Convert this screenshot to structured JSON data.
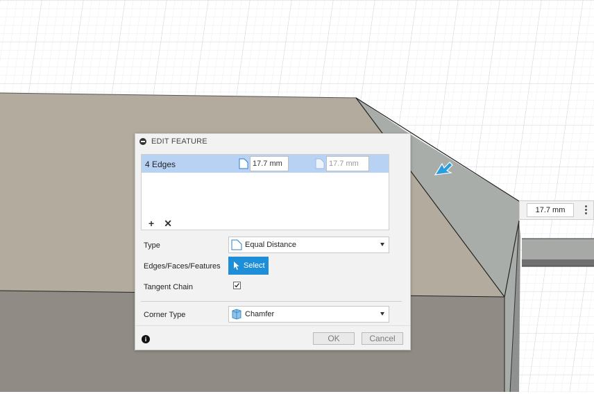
{
  "dialog": {
    "title": "EDIT FEATURE",
    "selection": {
      "label": "4 Edges",
      "distance_1": "17.7 mm",
      "distance_2": "17.7 mm"
    },
    "type": {
      "label": "Type",
      "value": "Equal Distance"
    },
    "edges": {
      "label": "Edges/Faces/Features",
      "button": "Select"
    },
    "tangent_chain": {
      "label": "Tangent Chain",
      "checked": true
    },
    "corner_type": {
      "label": "Corner Type",
      "value": "Chamfer"
    },
    "ok_label": "OK",
    "cancel_label": "Cancel"
  },
  "viewport": {
    "manipulator_value": "17.7 mm"
  },
  "colors": {
    "accent": "#1e8ed8",
    "selection_row": "#b8d2f4",
    "body_face": "#b3ab9e",
    "chamfer_face": "#a9ada9"
  }
}
